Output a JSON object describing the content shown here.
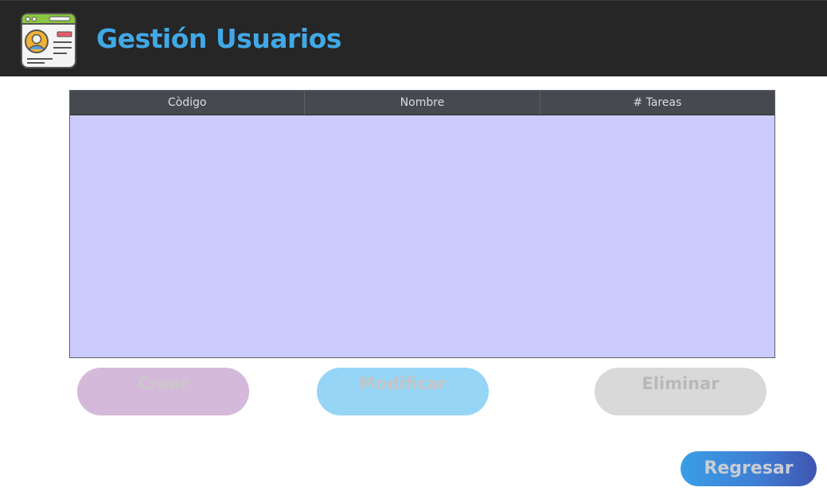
{
  "header": {
    "title": "Gestión Usuarios",
    "logo_icon": "user-profile-card-icon"
  },
  "table": {
    "columns": [
      "Còdigo",
      "Nombre",
      "# Tareas"
    ],
    "rows": []
  },
  "actions": {
    "crear_label": "Crear",
    "modificar_label": "Modificar",
    "eliminar_label": "Eliminar",
    "regresar_label": "Regresar"
  },
  "colors": {
    "header_bg": "#262626",
    "title": "#41a8e6",
    "table_header_bg": "#464a4e",
    "table_body_bg": "#ccccfc",
    "crear_bg": "#d5b9da",
    "modificar_bg": "#96d5f6",
    "eliminar_bg": "#d9d9d9",
    "regresar_bg": "#3f7fd4"
  }
}
